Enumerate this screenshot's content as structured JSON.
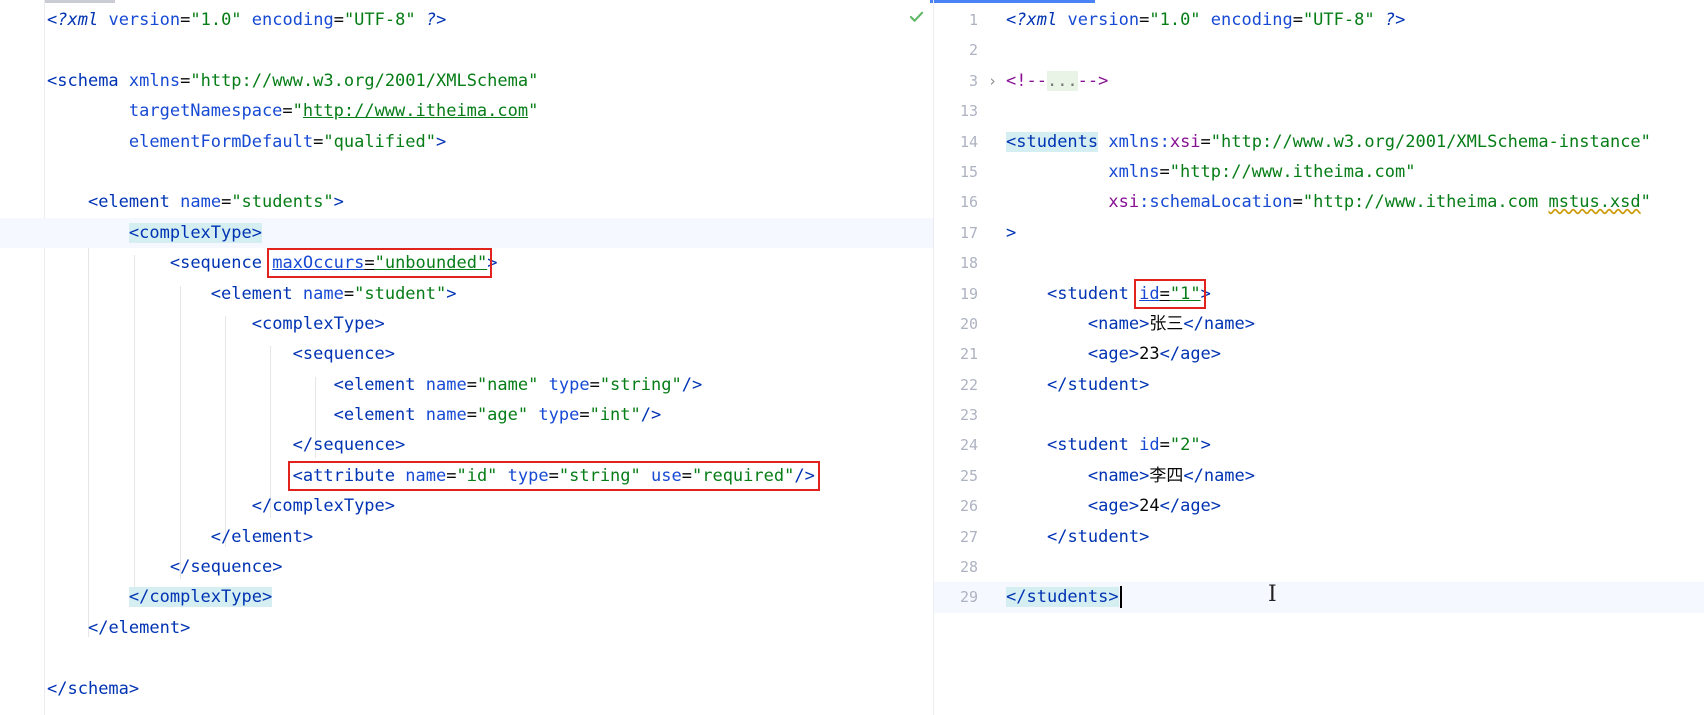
{
  "left_editor": {
    "line_1": {
      "pi_open": "<?",
      "pi_name": "xml",
      "a1": "version",
      "v1": "\"1.0\"",
      "a2": "encoding",
      "v2": "\"UTF-8\"",
      "pi_close": "?>"
    },
    "line_3": {
      "tag": "schema",
      "a1": "xmlns",
      "v1": "\"http://www.w3.org/2001/XMLSchema\""
    },
    "line_4": {
      "a1": "targetNamespace",
      "v1_url": "http://www.itheima.com"
    },
    "line_5": {
      "a1": "elementFormDefault",
      "v1": "\"qualified\""
    },
    "line_7": {
      "tag": "element",
      "a1": "name",
      "v1": "\"students\""
    },
    "line_8": {
      "tag": "complexType"
    },
    "line_9": {
      "tag": "sequence",
      "a1": "maxOccurs",
      "v1": "\"unbounded\""
    },
    "line_10": {
      "tag": "element",
      "a1": "name",
      "v1": "\"student\""
    },
    "line_11": {
      "tag": "complexType"
    },
    "line_12": {
      "tag": "sequence"
    },
    "line_13": {
      "tag": "element",
      "a1": "name",
      "v1": "\"name\"",
      "a2": "type",
      "v2": "\"string\""
    },
    "line_14": {
      "tag": "element",
      "a1": "name",
      "v1": "\"age\"",
      "a2": "type",
      "v2": "\"int\""
    },
    "line_15": {
      "tag": "sequence"
    },
    "line_16": {
      "tag": "attribute",
      "a1": "name",
      "v1": "\"id\"",
      "a2": "type",
      "v2": "\"string\"",
      "a3": "use",
      "v3": "\"required\""
    },
    "line_17": {
      "tag": "complexType"
    },
    "line_18": {
      "tag": "element"
    },
    "line_19": {
      "tag": "sequence"
    },
    "line_20": {
      "tag": "complexType"
    },
    "line_21": {
      "tag": "element"
    },
    "line_23": {
      "tag": "schema"
    }
  },
  "right_editor": {
    "line_numbers": [
      "1",
      "2",
      "3",
      "13",
      "14",
      "15",
      "16",
      "17",
      "18",
      "19",
      "20",
      "21",
      "22",
      "23",
      "24",
      "25",
      "26",
      "27",
      "28",
      "29"
    ],
    "line_1": {
      "pi_open": "<?",
      "pi_name": "xml",
      "a1": "version",
      "v1": "\"1.0\"",
      "a2": "encoding",
      "v2": "\"UTF-8\"",
      "pi_close": "?>"
    },
    "line_3": {
      "comment_open": "<!--",
      "folded": "...",
      "comment_close": "-->"
    },
    "line_14": {
      "tag": "students",
      "a1_ns": "xmlns",
      "a1_sep": ":",
      "a1_local": "xsi",
      "v1": "\"http://www.w3.org/2001/XMLSchema-instance\""
    },
    "line_15": {
      "a1": "xmlns",
      "v1": "\"http://www.itheima.com\""
    },
    "line_16": {
      "a1_ns": "xsi",
      "a1_sep": ":",
      "a1_local": "schemaLocation",
      "v1_pre": "\"http://www.itheima.com ",
      "v1_file": "mstus.xsd",
      "v1_post": "\""
    },
    "line_17": {
      "text": ">"
    },
    "line_19": {
      "tag": "student",
      "a1": "id",
      "v1": "\"1\""
    },
    "line_20": {
      "tag": "name",
      "text": "张三"
    },
    "line_21": {
      "tag": "age",
      "text": "23"
    },
    "line_22": {
      "tag": "student"
    },
    "line_24": {
      "tag": "student",
      "a1": "id",
      "v1": "\"2\""
    },
    "line_25": {
      "tag": "name",
      "text": "李四"
    },
    "line_26": {
      "tag": "age",
      "text": "24"
    },
    "line_27": {
      "tag": "student"
    },
    "line_29": {
      "tag": "students"
    }
  },
  "icons": {
    "inspection_ok": "check-icon",
    "mouse_cursor": "i-beam-cursor-icon"
  },
  "colors": {
    "annotation_box": "#e0241d",
    "inspection_ok": "#5fb865",
    "caret_line": "#f5f8fe",
    "tag_match_highlight": "#d5eef2"
  }
}
